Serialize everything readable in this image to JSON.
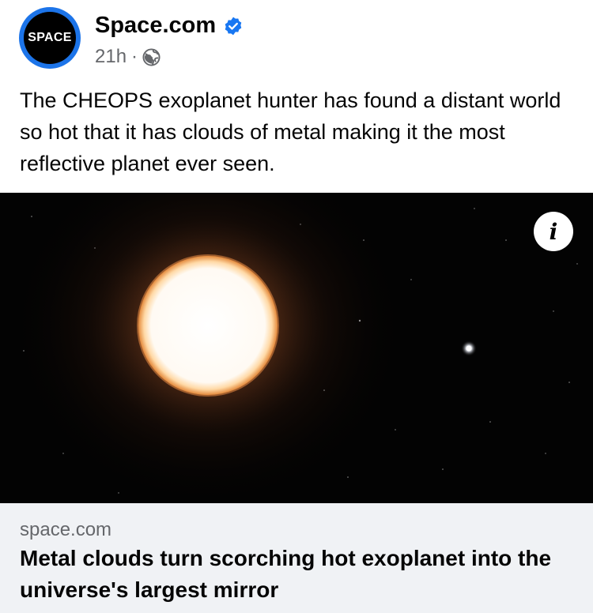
{
  "post": {
    "page": {
      "avatar_text": "SPACE",
      "name": "Space.com",
      "verified_icon": "verified-check-icon",
      "time": "21h",
      "separator": "·",
      "audience_icon": "globe-icon"
    },
    "caption": "The CHEOPS exoplanet hunter has found a distant world so hot that it has clouds of metal making it the most reflective planet ever seen.",
    "image": {
      "info_label": "i",
      "info_icon": "info-icon"
    },
    "link_preview": {
      "domain": "space.com",
      "title": "Metal clouds turn scorching hot exoplanet into the universe's largest mirror"
    }
  },
  "colors": {
    "verified": "#1877f2",
    "secondary_text": "#65676b",
    "link_bg": "#f0f2f5",
    "avatar_ring": "#1c74e9"
  }
}
